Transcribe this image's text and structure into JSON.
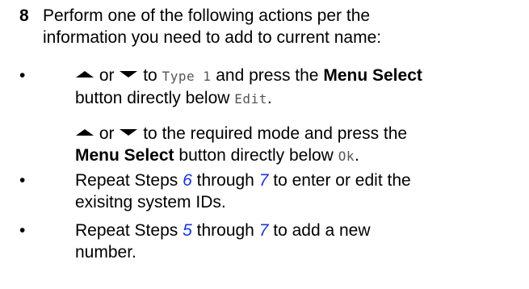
{
  "step": {
    "number": "8",
    "text_line1": "Perform one of the following actions per the",
    "text_line2": "information you need to add to current name:"
  },
  "bullet_char": "•",
  "bullet1": {
    "or": "or",
    "to": "to",
    "mode_name": "Type 1",
    "and_press_the": "and press the",
    "menu_select": "Menu Select",
    "button_directly_below": "button directly below",
    "softkey": "Edit",
    "period": "."
  },
  "bullet1_cont": {
    "or": "or",
    "rest1": "to the required mode and press the",
    "menu_select": "Menu Select",
    "button_directly_below": "button directly below",
    "softkey": "Ok",
    "period": "."
  },
  "bullet2": {
    "repeat_steps": "Repeat Steps",
    "step_from": "6",
    "through": "through",
    "step_to": "7",
    "rest1": "to enter or edit the",
    "line2": "exisitng system IDs."
  },
  "bullet3": {
    "repeat_steps": "Repeat Steps",
    "step_from": "5",
    "through": "through",
    "step_to": "7",
    "rest1": "to add a new",
    "line2": "number."
  },
  "icons": {
    "up": "up-arrow-icon",
    "down": "down-arrow-icon"
  },
  "colors": {
    "link": "#1a36d4",
    "softkey_text": "#555555"
  }
}
